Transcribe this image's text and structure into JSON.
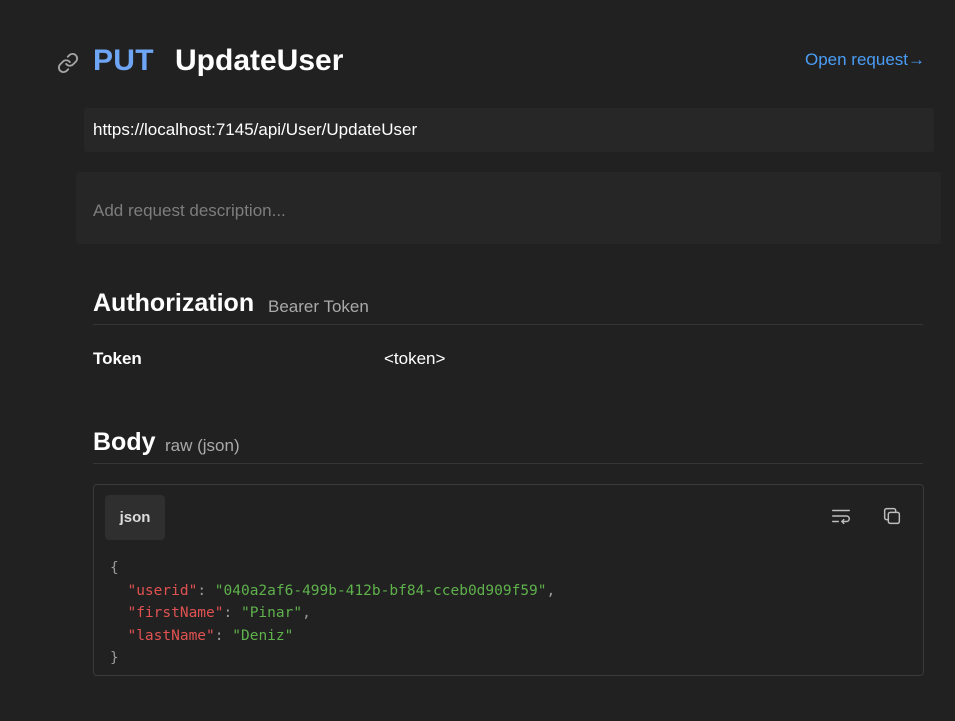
{
  "header": {
    "method": "PUT",
    "name": "UpdateUser",
    "open_request": "Open request→"
  },
  "url": "https://localhost:7145/api/User/UpdateUser",
  "description": {
    "placeholder": "Add request description..."
  },
  "authorization": {
    "title": "Authorization",
    "type": "Bearer Token",
    "key": "Token",
    "value": "<token>"
  },
  "body": {
    "title": "Body",
    "mode": "raw (json)",
    "language": "json",
    "open_brace": "{",
    "close_brace": "}",
    "fields": [
      {
        "key": "\"userid\"",
        "value": "\"040a2af6-499b-412b-bf84-cceb0d909f59\"",
        "sep": ","
      },
      {
        "key": "\"firstName\"",
        "value": "\"Pinar\"",
        "sep": ","
      },
      {
        "key": "\"lastName\"",
        "value": "\"Deniz\"",
        "sep": ""
      }
    ]
  },
  "colors": {
    "background": "#212121",
    "method": "#6ea6f5",
    "link": "#4a9df5",
    "json_key": "#e05252",
    "json_string": "#5fb14c"
  }
}
